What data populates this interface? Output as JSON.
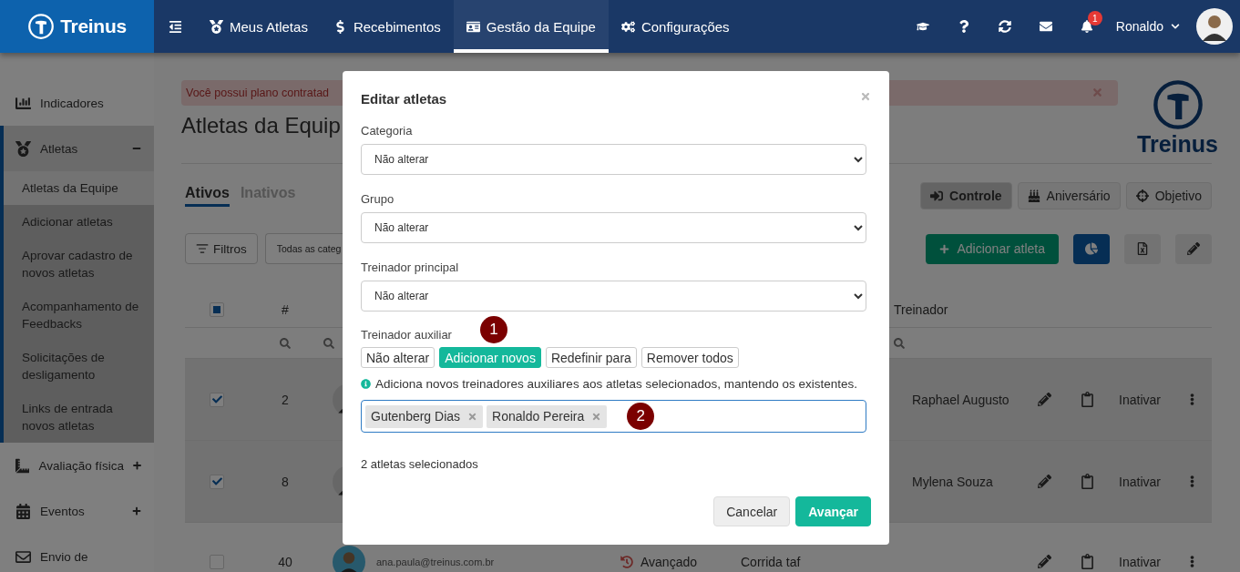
{
  "top_nav": {
    "brand": "Treinus",
    "items": [
      {
        "label": "Meus Atletas",
        "selected": false
      },
      {
        "label": "Recebimentos",
        "selected": false
      },
      {
        "label": "Gestão da Equipe",
        "selected": true
      },
      {
        "label": "Configurações",
        "selected": false
      }
    ],
    "user_name": "Ronaldo",
    "notification_count": "1"
  },
  "sidebar": {
    "items": [
      {
        "label": "Indicadores",
        "selected": false
      },
      {
        "label": "Atletas",
        "selected": true,
        "expanded": true,
        "children": [
          {
            "label": "Atletas da Equipe",
            "selected": true
          },
          {
            "label": "Adicionar atletas",
            "selected": false
          },
          {
            "label": "Aprovar cadastro de novos atletas",
            "selected": false
          },
          {
            "label": "Acompanhamento de Feedbacks",
            "selected": false
          },
          {
            "label": "Solicitações de desligamento",
            "selected": false
          },
          {
            "label": "Links de entrada novos atletas",
            "selected": false
          }
        ]
      },
      {
        "label": "Avaliação física",
        "selected": false,
        "expanded": false
      },
      {
        "label": "Eventos",
        "selected": false,
        "expanded": false
      },
      {
        "label": "Envio de",
        "selected": false
      }
    ]
  },
  "alert": {
    "text": "Você possui plano contratad"
  },
  "page_title": "Atletas da Equip",
  "brand_logo": "Treinus",
  "tabs": [
    {
      "label": "Ativos",
      "selected": true
    },
    {
      "label": "Inativos",
      "selected": false
    }
  ],
  "view_buttons": [
    {
      "label": "Controle",
      "selected": true
    },
    {
      "label": "Aniversário",
      "selected": false
    },
    {
      "label": "Objetivo",
      "selected": false
    }
  ],
  "filters": {
    "button": "Filtros",
    "category_select": "Todas as categ"
  },
  "add_button": "Adicionar atleta",
  "table": {
    "columns": {
      "number": "#",
      "trainer": "Treinador"
    },
    "header_indeterminate": true,
    "rows": [
      {
        "checked": true,
        "number": "2",
        "trainer": "Raphael Augusto",
        "action": "Inativar"
      },
      {
        "checked": true,
        "number": "8",
        "trainer": "Mylena Souza",
        "action": "Inativar"
      },
      {
        "checked": false,
        "number": "40",
        "email": "ana.paula@treinus.com.br",
        "level": "Avançado",
        "modality": "Corrida taf",
        "action": "Inativar"
      }
    ]
  },
  "modal": {
    "title": "Editar atletas",
    "fields": [
      {
        "label": "Categoria",
        "value": "Não alterar"
      },
      {
        "label": "Grupo",
        "value": "Não alterar"
      },
      {
        "label": "Treinador principal",
        "value": "Não alterar"
      }
    ],
    "aux_trainer": {
      "label": "Treinador auxiliar",
      "modes": [
        {
          "label": "Não alterar",
          "selected": false
        },
        {
          "label": "Adicionar novos",
          "selected": true
        },
        {
          "label": "Redefinir para",
          "selected": false
        },
        {
          "label": "Remover todos",
          "selected": false
        }
      ],
      "hint": "Adiciona novos treinadores auxiliares aos atletas selecionados, mantendo os existentes.",
      "tags": [
        "Gutenberg Dias",
        "Ronaldo Pereira"
      ]
    },
    "summary": "2 atletas selecionados",
    "buttons": [
      {
        "label": "Cancelar",
        "kind": "secondary"
      },
      {
        "label": "Avançar",
        "kind": "primary"
      }
    ]
  },
  "annotations": [
    {
      "number": "1"
    },
    {
      "number": "2"
    }
  ]
}
